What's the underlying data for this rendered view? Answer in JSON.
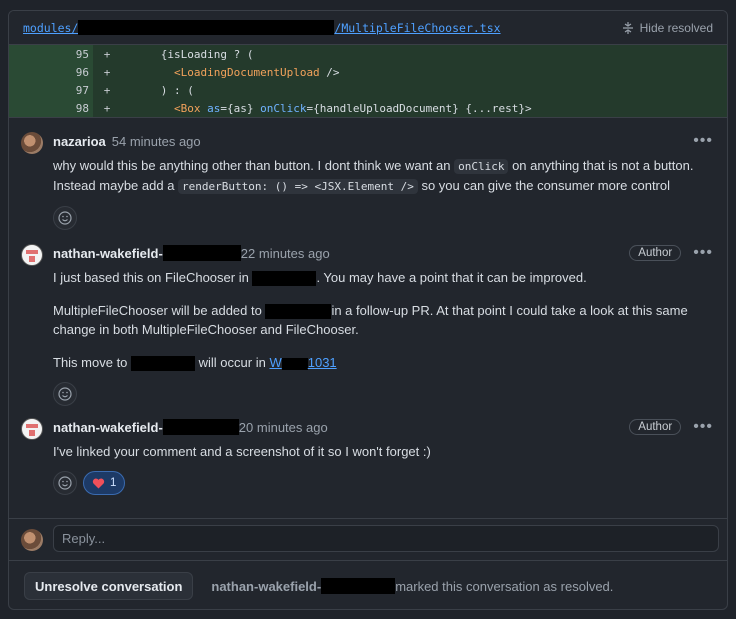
{
  "file_header": {
    "path_prefix": "modules/",
    "path_suffix": "/MultipleFileChooser.tsx",
    "hide_resolved": "Hide resolved"
  },
  "code_lines": [
    {
      "num": "95",
      "sign": "+",
      "text": "      {isLoading ? ("
    },
    {
      "num": "96",
      "sign": "+",
      "text_pre": "        <",
      "tag": "LoadingDocumentUpload",
      "text_post": " />"
    },
    {
      "num": "97",
      "sign": "+",
      "text": "      ) : ("
    },
    {
      "num": "98",
      "sign": "+",
      "text_pre": "        <",
      "tag": "Box",
      "attrs": " as",
      "text_mid": "={as} ",
      "attr2": "onClick",
      "text_post": "={handleUploadDocument} {...rest}>"
    }
  ],
  "comments": [
    {
      "author": "nazarioa",
      "time": "54 minutes ago",
      "p1_a": "why would this be anything other than button. I dont think we want an ",
      "p1_code": "onClick",
      "p1_b": " on anything that is not a button.",
      "p2_a": "Instead maybe add a ",
      "p2_code": "renderButton: () => <JSX.Element />",
      "p2_b": " so you can give the consumer more control"
    },
    {
      "author": "nathan-wakefield-",
      "time": "22 minutes ago",
      "badge": "Author",
      "p1_a": "I just based this on FileChooser in ",
      "p1_b": ". You may have a point that it can be improved.",
      "p2_a": "MultipleFileChooser will be added to ",
      "p2_b": "in a follow-up PR. At that point I could take a look at this same",
      "p2_c": "change in both MultipleFileChooser and FileChooser.",
      "p3_a": "This move to ",
      "p3_b": " will occur in ",
      "p3_link_a": "W",
      "p3_link_b": "1031"
    },
    {
      "author": "nathan-wakefield-",
      "time": "20 minutes ago",
      "badge": "Author",
      "p1": "I've linked your comment and a screenshot of it so I won't forget :)",
      "reaction_count": "1"
    }
  ],
  "reply": {
    "placeholder": "Reply..."
  },
  "footer": {
    "button": "Unresolve conversation",
    "user": "nathan-wakefield-",
    "text": "marked this conversation as resolved."
  },
  "icons": [
    "hide-resolved-icon",
    "kebab-icon",
    "smiley-icon",
    "heart-icon"
  ]
}
